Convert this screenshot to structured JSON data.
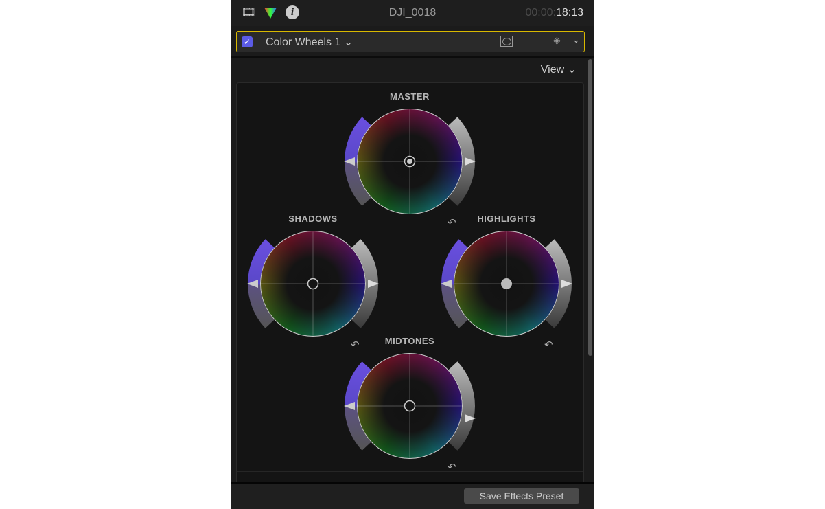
{
  "topbar": {
    "icons": [
      "film-icon",
      "color-inspector-icon",
      "info-icon"
    ],
    "clip_name": "DJI_0018",
    "timecode_dim": "00:00:",
    "timecode": "18:13"
  },
  "effect": {
    "enabled": true,
    "name": "Color Wheels 1 ⌄",
    "mask_icon": "shape-mask-icon",
    "keyframe_icon": "keyframe-icon",
    "chevron": "⌄"
  },
  "view_label": "View ⌄",
  "wheels": [
    {
      "id": "master",
      "label": "MASTER",
      "puck": "ring-dot",
      "saturation": 0,
      "brightness": 0
    },
    {
      "id": "shadows",
      "label": "SHADOWS",
      "puck": "ring",
      "saturation": 0,
      "brightness": 0
    },
    {
      "id": "highlights",
      "label": "HIGHLIGHTS",
      "puck": "filled",
      "saturation": 0,
      "brightness": 0
    },
    {
      "id": "midtones",
      "label": "MIDTONES",
      "puck": "ring",
      "saturation": 0,
      "brightness": -0.3
    }
  ],
  "reset_glyph": "↶",
  "colors": {
    "accent": "#5b5be6",
    "selection": "#d8b800",
    "saturation_slider": "#6a4fe0"
  },
  "footer": {
    "save_preset": "Save Effects Preset"
  }
}
